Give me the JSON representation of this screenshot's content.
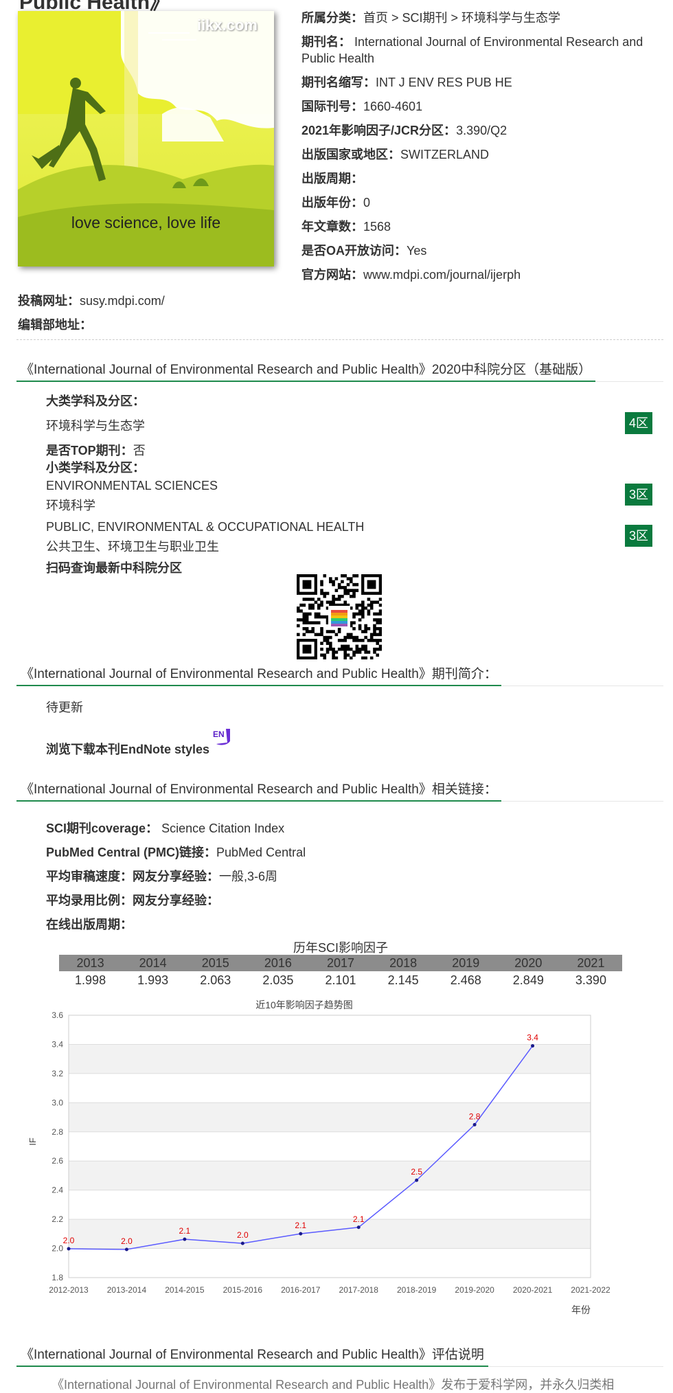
{
  "page_title": "Public Health》",
  "cover": {
    "watermark": "iikx.com",
    "slogan": "love science, love life"
  },
  "info": [
    {
      "label": "所属分类：",
      "value": "首页 > SCI期刊 > 环境科学与生态学"
    },
    {
      "label": "期刊名：",
      "value": " International Journal of Environmental Research and Public Health"
    },
    {
      "label": "期刊名缩写：",
      "value": "INT J ENV RES PUB HE"
    },
    {
      "label": "国际刊号：",
      "value": "1660-4601"
    },
    {
      "label": "2021年影响因子/JCR分区：",
      "value": "3.390/Q2"
    },
    {
      "label": "出版国家或地区：",
      "value": "SWITZERLAND"
    },
    {
      "label": "出版周期：",
      "value": ""
    },
    {
      "label": "出版年份：",
      "value": "0"
    },
    {
      "label": "年文章数：",
      "value": "1568"
    },
    {
      "label": "是否OA开放访问：",
      "value": "Yes"
    },
    {
      "label": "官方网站：",
      "value": "www.mdpi.com/journal/ijerph"
    }
  ],
  "submission": {
    "label": "投稿网址：",
    "value": "susy.mdpi.com/"
  },
  "editorial": {
    "label": "编辑部地址：",
    "value": ""
  },
  "cas": {
    "heading": "《International Journal of Environmental Research and Public Health》2020中科院分区（基础版）",
    "major_label": "大类学科及分区：",
    "major_subject": "环境科学与生态学",
    "major_zone": "4区",
    "top_label": "是否TOP期刊：",
    "top_value": "否",
    "minor_label": "小类学科及分区：",
    "minor": [
      {
        "en": "ENVIRONMENTAL SCIENCES",
        "cn": "环境科学",
        "zone": "3区"
      },
      {
        "en": "PUBLIC, ENVIRONMENTAL & OCCUPATIONAL HEALTH",
        "cn": "公共卫生、环境卫生与职业卫生",
        "zone": "3区"
      }
    ],
    "qr_label": "扫码查询最新中科院分区"
  },
  "intro": {
    "heading": "《International Journal of Environmental Research and Public Health》期刊简介：",
    "text": "待更新",
    "endnote": "浏览下载本刊EndNote styles",
    "endnote_icon": "EN"
  },
  "links": {
    "heading": "《International Journal of Environmental Research and Public Health》相关链接：",
    "rows": [
      {
        "label": "SCI期刊coverage：",
        "value": " Science Citation Index"
      },
      {
        "label": "PubMed Central (PMC)链接：",
        "value": "PubMed Central"
      },
      {
        "label": "平均审稿速度：网友分享经验：",
        "value": "一般,3-6周"
      },
      {
        "label": "平均录用比例：网友分享经验：",
        "value": ""
      },
      {
        "label": "在线出版周期：",
        "value": ""
      }
    ]
  },
  "if_table": {
    "title": "历年SCI影响因子",
    "years": [
      "2013",
      "2014",
      "2015",
      "2016",
      "2017",
      "2018",
      "2019",
      "2020",
      "2021"
    ],
    "values": [
      "1.998",
      "1.993",
      "2.063",
      "2.035",
      "2.101",
      "2.145",
      "2.468",
      "2.849",
      "3.390"
    ]
  },
  "chart_data": {
    "type": "line",
    "title": "近10年影响因子趋势图",
    "xlabel": "年份",
    "ylabel": "IF",
    "categories": [
      "2012-2013",
      "2013-2014",
      "2014-2015",
      "2015-2016",
      "2016-2017",
      "2017-2018",
      "2018-2019",
      "2019-2020",
      "2020-2021",
      "2021-2022"
    ],
    "values": [
      1.998,
      1.993,
      2.063,
      2.035,
      2.101,
      2.145,
      2.468,
      2.849,
      3.39,
      null
    ],
    "data_labels": [
      "2.0",
      "2.0",
      "2.1",
      "2.0",
      "2.1",
      "2.1",
      "2.5",
      "2.8",
      "3.4",
      ""
    ],
    "ylim": [
      1.8,
      3.6
    ],
    "yticks": [
      "1.8",
      "2.0",
      "2.2",
      "2.4",
      "2.6",
      "2.8",
      "3.0",
      "3.2",
      "3.4",
      "3.6"
    ],
    "grid": true,
    "colors": {
      "line": "#5a5aff",
      "label": "#e00000",
      "band": "#f2f2f2"
    }
  },
  "eval": {
    "heading": "《International Journal of Environmental Research and Public Health》评估说明",
    "text": "《International Journal of Environmental Research and Public Health》发布于爱科学网，并永久归类相"
  },
  "colors": {
    "accent": "#1e8a4c",
    "badge": "#0a7a3e"
  }
}
